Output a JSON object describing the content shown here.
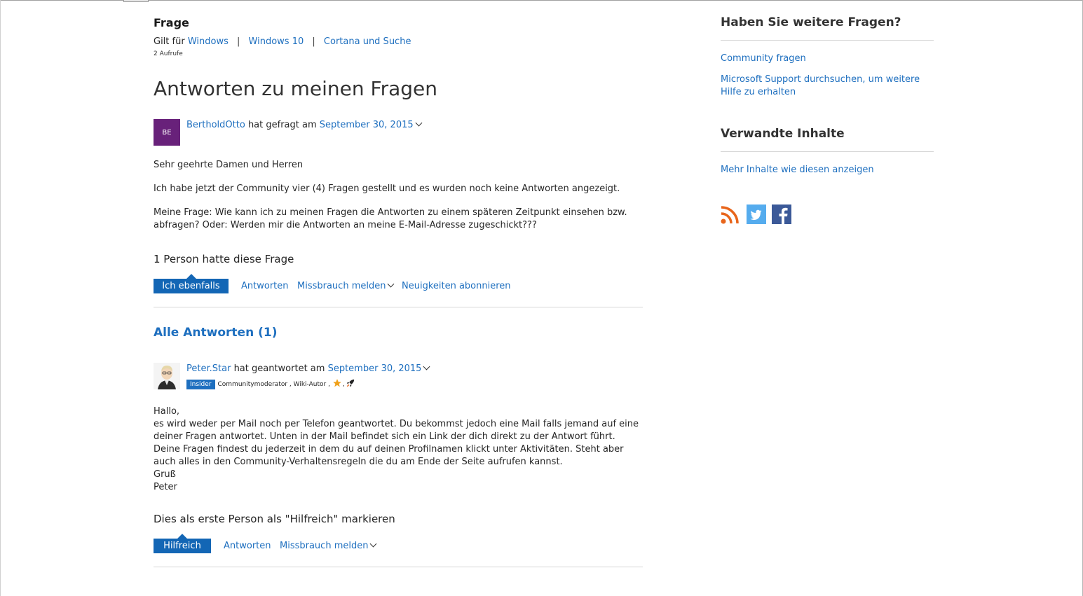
{
  "question": {
    "label": "Frage",
    "applies_prefix": "Gilt für",
    "applies": [
      "Windows",
      "Windows 10",
      "Cortana und Suche"
    ],
    "separator": "|",
    "views": "2 Aufrufe",
    "title": "Antworten zu meinen Fragen",
    "author_initials": "BE",
    "author": "BertholdOtto",
    "asked_text": "hat gefragt am",
    "date": "September 30, 2015",
    "body": [
      "Sehr geehrte Damen und Herren",
      "Ich habe jetzt der Community vier (4) Fragen gestellt und es wurden noch keine Antworten angezeigt.",
      "Meine Frage: Wie kann ich zu meinen Fragen die Antworten zu einem späteren Zeitpunkt einsehen bzw. abfragen? Oder: Werden mir die Antworten an meine E-Mail-Adresse zugeschickt???"
    ],
    "count_text": "1 Person hatte diese Frage",
    "actions": {
      "same": "Ich ebenfalls",
      "reply": "Antworten",
      "report": "Missbrauch melden",
      "subscribe": "Neuigkeiten abonnieren"
    }
  },
  "answers": {
    "heading": "Alle Antworten (1)",
    "items": [
      {
        "author": "Peter.Star",
        "answered_text": "hat geantwortet am",
        "date": "September 30, 2015",
        "badge": "Insider",
        "roles": "Communitymoderator , Wiki-Autor ,",
        "body": [
          "Hallo,",
          "es wird weder per Mail noch per Telefon geantwortet. Du bekommst jedoch eine Mail falls jemand auf eine deiner Fragen antwortet. Unten in der Mail befindet sich ein Link der dich direkt zu der Antwort führt. Deine Fragen findest du jederzeit in dem du auf deinen Profilnamen klickt unter Aktivitäten. Steht aber auch alles in den Community-Verhaltensregeln die du am Ende der Seite aufrufen kannst.",
          "Gruß",
          "Peter"
        ],
        "helpful_prompt": "Dies als erste Person als \"Hilfreich\" markieren",
        "actions": {
          "helpful": "Hilfreich",
          "reply": "Antworten",
          "report": "Missbrauch melden"
        }
      }
    ]
  },
  "sidebar": {
    "more_questions_heading": "Haben Sie weitere Fragen?",
    "ask_link": "Community fragen",
    "search_link": "Microsoft Support durchsuchen, um weitere Hilfe zu erhalten",
    "related_heading": "Verwandte Inhalte",
    "more_link": "Mehr Inhalte wie diesen anzeigen",
    "social_icons": [
      "rss-icon",
      "twitter-icon",
      "facebook-icon"
    ]
  },
  "colors": {
    "link": "#1e6fbf",
    "button": "#1366b5",
    "avatar": "#68217a",
    "rss": "#e8651b",
    "twitter": "#55acee",
    "facebook": "#3b5998"
  }
}
